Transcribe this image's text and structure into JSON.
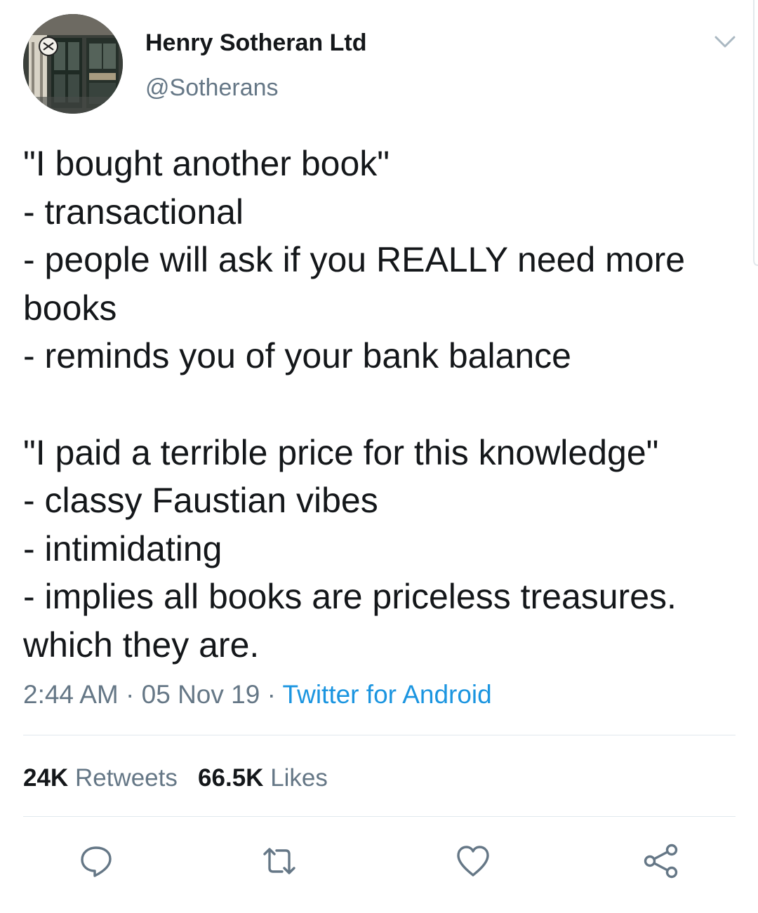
{
  "author": {
    "display_name": "Henry Sotheran Ltd",
    "handle": "@Sotherans",
    "avatar_icon": "bookshop-storefront-avatar"
  },
  "tweet": {
    "lines": [
      "\"I bought another book\"",
      "- transactional",
      "- people will ask if you REALLY need more",
      "books",
      "- reminds you of your bank balance",
      "",
      "\"I paid a terrible price for this knowledge\"",
      "- classy Faustian vibes",
      "- intimidating",
      "- implies all books are priceless treasures.",
      "which they are."
    ]
  },
  "meta": {
    "time": "2:44 AM",
    "separator": " · ",
    "date": "05 Nov 19",
    "source": "Twitter for Android"
  },
  "stats": {
    "retweets_count": "24K",
    "retweets_label": "Retweets",
    "likes_count": "66.5K",
    "likes_label": "Likes"
  },
  "actions": {
    "icons": [
      "reply-icon",
      "retweet-icon",
      "like-icon",
      "share-icon"
    ]
  },
  "colors": {
    "text_primary": "#14171a",
    "text_secondary": "#657786",
    "link": "#1b95e0",
    "divider": "#e1e8ed"
  }
}
